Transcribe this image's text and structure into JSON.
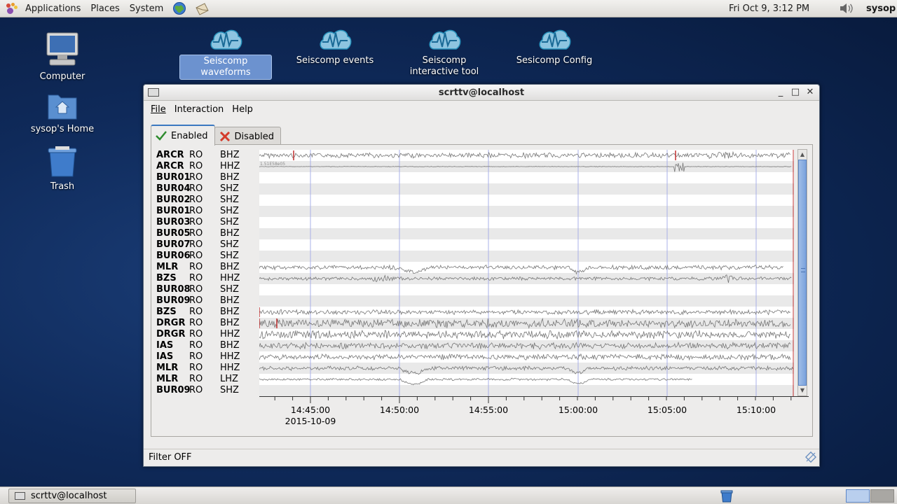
{
  "top_panel": {
    "menus": [
      "Applications",
      "Places",
      "System"
    ],
    "clock": "Fri Oct  9,  3:12 PM",
    "user": "sysop"
  },
  "desktop": {
    "icons": [
      {
        "label": "Computer",
        "icon": "computer-icon"
      },
      {
        "label": "sysop's Home",
        "icon": "home-folder-icon"
      },
      {
        "label": "Trash",
        "icon": "trash-icon"
      }
    ],
    "launchers": [
      {
        "label": "Seiscomp waveforms",
        "icon": "waveform-icon",
        "selected": true
      },
      {
        "label": "Seiscomp events",
        "icon": "waveform-icon"
      },
      {
        "label": "Seiscomp interactive tool",
        "icon": "waveform-icon"
      },
      {
        "label": "Sesicomp Config",
        "icon": "waveform-icon"
      }
    ]
  },
  "window": {
    "title": "scrttv@localhost",
    "menus": [
      "File",
      "Interaction",
      "Help"
    ],
    "tabs": [
      {
        "label": "Enabled",
        "icon": "check-icon",
        "active": true
      },
      {
        "label": "Disabled",
        "icon": "x-icon",
        "active": false
      }
    ],
    "status": "Filter OFF",
    "traces": [
      {
        "sta": "ARCR",
        "net": "RO",
        "cha": "BHZ"
      },
      {
        "sta": "ARCR",
        "net": "RO",
        "cha": "HHZ"
      },
      {
        "sta": "BUR01",
        "net": "RO",
        "cha": "BHZ"
      },
      {
        "sta": "BUR04",
        "net": "RO",
        "cha": "SHZ"
      },
      {
        "sta": "BUR02",
        "net": "RO",
        "cha": "SHZ"
      },
      {
        "sta": "BUR01",
        "net": "RO",
        "cha": "SHZ"
      },
      {
        "sta": "BUR03",
        "net": "RO",
        "cha": "SHZ"
      },
      {
        "sta": "BUR05",
        "net": "RO",
        "cha": "BHZ"
      },
      {
        "sta": "BUR07",
        "net": "RO",
        "cha": "SHZ"
      },
      {
        "sta": "BUR06",
        "net": "RO",
        "cha": "SHZ"
      },
      {
        "sta": "MLR",
        "net": "RO",
        "cha": "BHZ"
      },
      {
        "sta": "BZS",
        "net": "RO",
        "cha": "HHZ"
      },
      {
        "sta": "BUR08",
        "net": "RO",
        "cha": "SHZ"
      },
      {
        "sta": "BUR09",
        "net": "RO",
        "cha": "BHZ"
      },
      {
        "sta": "BZS",
        "net": "RO",
        "cha": "BHZ"
      },
      {
        "sta": "DRGR",
        "net": "RO",
        "cha": "BHZ"
      },
      {
        "sta": "DRGR",
        "net": "RO",
        "cha": "HHZ"
      },
      {
        "sta": "IAS",
        "net": "RO",
        "cha": "BHZ"
      },
      {
        "sta": "IAS",
        "net": "RO",
        "cha": "HHZ"
      },
      {
        "sta": "MLR",
        "net": "RO",
        "cha": "HHZ"
      },
      {
        "sta": "MLR",
        "net": "RO",
        "cha": "LHZ"
      },
      {
        "sta": "BUR09",
        "net": "RO",
        "cha": "SHZ"
      }
    ],
    "trace_annotation": "1.51E58e05",
    "time_axis": {
      "ticks": [
        "14:45:00",
        "14:50:00",
        "14:55:00",
        "15:00:00",
        "15:05:00",
        "15:10:00"
      ],
      "date": "2015-10-09"
    }
  },
  "bottom_panel": {
    "task": "scrttv@localhost"
  },
  "colors": {
    "desktop_bg": "#0f2a5a",
    "selection": "#6c92cf",
    "waveform": "#777777",
    "pick_marker": "#c03030",
    "grid": "#a9b0e8"
  }
}
